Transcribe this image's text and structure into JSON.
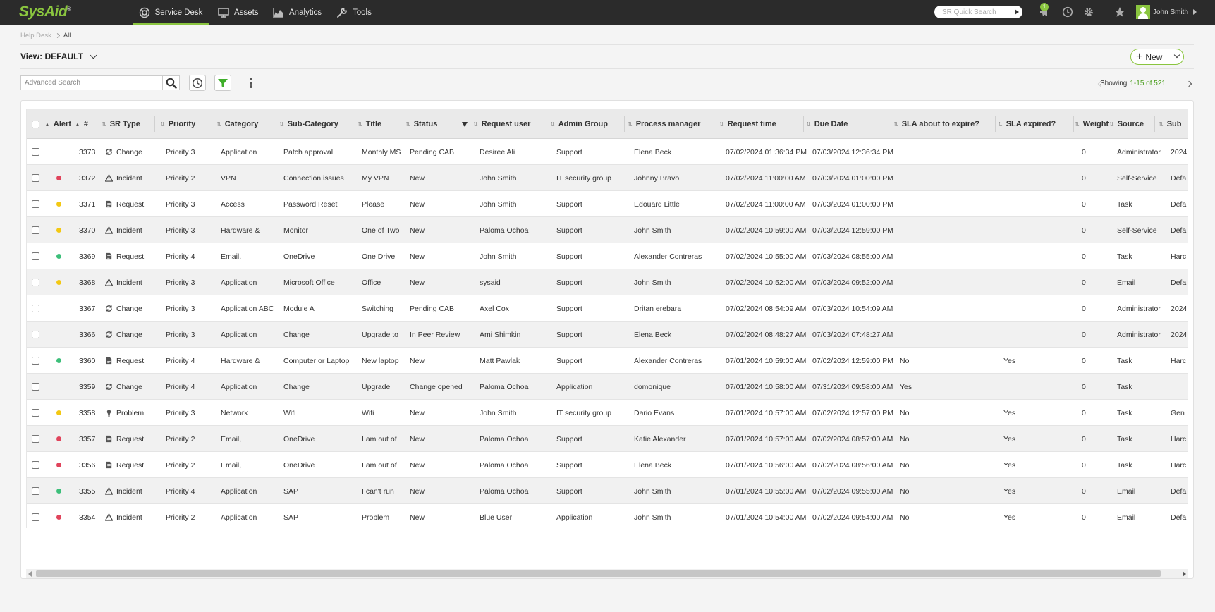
{
  "topbar": {
    "logo": "SysAid",
    "nav": [
      {
        "label": "Service Desk",
        "icon": "lifebuoy-icon",
        "active": true
      },
      {
        "label": "Assets",
        "icon": "monitor-icon",
        "active": false
      },
      {
        "label": "Analytics",
        "icon": "area-chart-icon",
        "active": false
      },
      {
        "label": "Tools",
        "icon": "wrench-icon",
        "active": false
      }
    ],
    "quick_search_placeholder": "SR Quick Search",
    "notification_count": "1",
    "user_name": "John Smith"
  },
  "breadcrumb": {
    "root": "Help Desk",
    "current": "All"
  },
  "view": {
    "label": "View: DEFAULT"
  },
  "new_button": {
    "label": "New"
  },
  "search": {
    "placeholder": "Advanced Search"
  },
  "pager": {
    "showing": "Showing",
    "range": "1-15 of 521"
  },
  "colors": {
    "accent": "#8ac53f",
    "alert_red": "#e0445c",
    "alert_yellow": "#f3c813",
    "alert_green": "#3dbf7a"
  },
  "columns": [
    "Alert",
    "#",
    "SR Type",
    "Priority",
    "Category",
    "Sub-Category",
    "Title",
    "Status",
    "Request user",
    "Admin Group",
    "Process manager",
    "Request time",
    "Due Date",
    "SLA about to expire?",
    "SLA expired?",
    "Weight",
    "Source",
    "Sub"
  ],
  "rows": [
    {
      "alert": "",
      "id": "3373",
      "type": "Change",
      "priority": "Priority 3",
      "category": "Application",
      "subcategory": "Patch approval",
      "title": "Monthly MS",
      "status": "Pending CAB",
      "request_user": "Desiree Ali",
      "admin_group": "Support",
      "process_manager": "Elena Beck",
      "request_time": "07/02/2024 01:36:34 PM",
      "due_date": "07/03/2024 12:36:34 PM",
      "sla_about": "",
      "sla_expired": "",
      "weight": "0",
      "source": "Administrator",
      "extra": "2024"
    },
    {
      "alert": "red",
      "id": "3372",
      "type": "Incident",
      "priority": "Priority 2",
      "category": "VPN",
      "subcategory": "Connection issues",
      "title": "My VPN",
      "status": "New",
      "request_user": "John Smith",
      "admin_group": "IT security group",
      "process_manager": "Johnny Bravo",
      "request_time": "07/02/2024 11:00:00 AM",
      "due_date": "07/03/2024 01:00:00 PM",
      "sla_about": "",
      "sla_expired": "",
      "weight": "0",
      "source": "Self-Service",
      "extra": "Defa"
    },
    {
      "alert": "yellow",
      "id": "3371",
      "type": "Request",
      "priority": "Priority 3",
      "category": "Access",
      "subcategory": "Password Reset",
      "title": "Please",
      "status": "New",
      "request_user": "John Smith",
      "admin_group": "Support",
      "process_manager": "Edouard Little",
      "request_time": "07/02/2024 11:00:00 AM",
      "due_date": "07/03/2024 01:00:00 PM",
      "sla_about": "",
      "sla_expired": "",
      "weight": "0",
      "source": "Task",
      "extra": "Defa"
    },
    {
      "alert": "yellow",
      "id": "3370",
      "type": "Incident",
      "priority": "Priority 3",
      "category": "Hardware &",
      "subcategory": "Monitor",
      "title": "One of Two",
      "status": "New",
      "request_user": "Paloma Ochoa",
      "admin_group": "Support",
      "process_manager": "John Smith",
      "request_time": "07/02/2024 10:59:00 AM",
      "due_date": "07/03/2024 12:59:00 PM",
      "sla_about": "",
      "sla_expired": "",
      "weight": "0",
      "source": "Self-Service",
      "extra": "Defa"
    },
    {
      "alert": "green",
      "id": "3369",
      "type": "Request",
      "priority": "Priority 4",
      "category": "Email,",
      "subcategory": "OneDrive",
      "title": "One Drive",
      "status": "New",
      "request_user": "John Smith",
      "admin_group": "Support",
      "process_manager": "Alexander Contreras",
      "request_time": "07/02/2024 10:55:00 AM",
      "due_date": "07/03/2024 08:55:00 AM",
      "sla_about": "",
      "sla_expired": "",
      "weight": "0",
      "source": "Task",
      "extra": "Harc"
    },
    {
      "alert": "yellow",
      "id": "3368",
      "type": "Incident",
      "priority": "Priority 3",
      "category": "Application",
      "subcategory": "Microsoft Office",
      "title": "Office",
      "status": "New",
      "request_user": "sysaid",
      "admin_group": "Support",
      "process_manager": "John Smith",
      "request_time": "07/02/2024 10:52:00 AM",
      "due_date": "07/03/2024 09:52:00 AM",
      "sla_about": "",
      "sla_expired": "",
      "weight": "0",
      "source": "Email",
      "extra": "Defa"
    },
    {
      "alert": "",
      "id": "3367",
      "type": "Change",
      "priority": "Priority 3",
      "category": "Application ABC",
      "subcategory": "Module A",
      "title": "Switching",
      "status": "Pending CAB",
      "request_user": "Axel Cox",
      "admin_group": "Support",
      "process_manager": "Dritan erebara",
      "request_time": "07/02/2024 08:54:09 AM",
      "due_date": "07/03/2024 10:54:09 AM",
      "sla_about": "",
      "sla_expired": "",
      "weight": "0",
      "source": "Administrator",
      "extra": "2024"
    },
    {
      "alert": "",
      "id": "3366",
      "type": "Change",
      "priority": "Priority 3",
      "category": "Application",
      "subcategory": "Change",
      "title": "Upgrade to",
      "status": "In Peer Review",
      "request_user": "Ami Shimkin",
      "admin_group": "Support",
      "process_manager": "Elena Beck",
      "request_time": "07/02/2024 08:48:27 AM",
      "due_date": "07/03/2024 07:48:27 AM",
      "sla_about": "",
      "sla_expired": "",
      "weight": "0",
      "source": "Administrator",
      "extra": "2024"
    },
    {
      "alert": "green",
      "id": "3360",
      "type": "Request",
      "priority": "Priority 4",
      "category": "Hardware &",
      "subcategory": "Computer or Laptop",
      "title": "New laptop",
      "status": "New",
      "request_user": "Matt Pawlak",
      "admin_group": "Support",
      "process_manager": "Alexander Contreras",
      "request_time": "07/01/2024 10:59:00 AM",
      "due_date": "07/02/2024 12:59:00 PM",
      "sla_about": "No",
      "sla_expired": "Yes",
      "weight": "0",
      "source": "Task",
      "extra": "Harc"
    },
    {
      "alert": "",
      "id": "3359",
      "type": "Change",
      "priority": "Priority 4",
      "category": "Application",
      "subcategory": "Change",
      "title": "Upgrade",
      "status": "Change opened",
      "request_user": "Paloma Ochoa",
      "admin_group": "Application",
      "process_manager": "domonique",
      "request_time": "07/01/2024 10:58:00 AM",
      "due_date": "07/31/2024 09:58:00 AM",
      "sla_about": "Yes",
      "sla_expired": "",
      "weight": "0",
      "source": "Task",
      "extra": ""
    },
    {
      "alert": "yellow",
      "id": "3358",
      "type": "Problem",
      "priority": "Priority 3",
      "category": "Network",
      "subcategory": "Wifi",
      "title": "Wifi",
      "status": "New",
      "request_user": "John Smith",
      "admin_group": "IT security group",
      "process_manager": "Dario Evans",
      "request_time": "07/01/2024 10:57:00 AM",
      "due_date": "07/02/2024 12:57:00 PM",
      "sla_about": "No",
      "sla_expired": "Yes",
      "weight": "0",
      "source": "Task",
      "extra": "Gen"
    },
    {
      "alert": "red",
      "id": "3357",
      "type": "Request",
      "priority": "Priority 2",
      "category": "Email,",
      "subcategory": "OneDrive",
      "title": "I am out of",
      "status": "New",
      "request_user": "Paloma Ochoa",
      "admin_group": "Support",
      "process_manager": "Katie Alexander",
      "request_time": "07/01/2024 10:57:00 AM",
      "due_date": "07/02/2024 08:57:00 AM",
      "sla_about": "No",
      "sla_expired": "Yes",
      "weight": "0",
      "source": "Task",
      "extra": "Harc"
    },
    {
      "alert": "red",
      "id": "3356",
      "type": "Request",
      "priority": "Priority 2",
      "category": "Email,",
      "subcategory": "OneDrive",
      "title": "I am out of",
      "status": "New",
      "request_user": "Paloma Ochoa",
      "admin_group": "Support",
      "process_manager": "Elena Beck",
      "request_time": "07/01/2024 10:56:00 AM",
      "due_date": "07/02/2024 08:56:00 AM",
      "sla_about": "No",
      "sla_expired": "Yes",
      "weight": "0",
      "source": "Task",
      "extra": "Harc"
    },
    {
      "alert": "green",
      "id": "3355",
      "type": "Incident",
      "priority": "Priority 4",
      "category": "Application",
      "subcategory": "SAP",
      "title": "I can't run",
      "status": "New",
      "request_user": "Paloma Ochoa",
      "admin_group": "Support",
      "process_manager": "John Smith",
      "request_time": "07/01/2024 10:55:00 AM",
      "due_date": "07/02/2024 09:55:00 AM",
      "sla_about": "No",
      "sla_expired": "Yes",
      "weight": "0",
      "source": "Email",
      "extra": "Defa"
    },
    {
      "alert": "red",
      "id": "3354",
      "type": "Incident",
      "priority": "Priority 2",
      "category": "Application",
      "subcategory": "SAP",
      "title": "Problem",
      "status": "New",
      "request_user": "Blue User",
      "admin_group": "Application",
      "process_manager": "John Smith",
      "request_time": "07/01/2024 10:54:00 AM",
      "due_date": "07/02/2024 09:54:00 AM",
      "sla_about": "No",
      "sla_expired": "Yes",
      "weight": "0",
      "source": "Email",
      "extra": "Defa"
    }
  ]
}
